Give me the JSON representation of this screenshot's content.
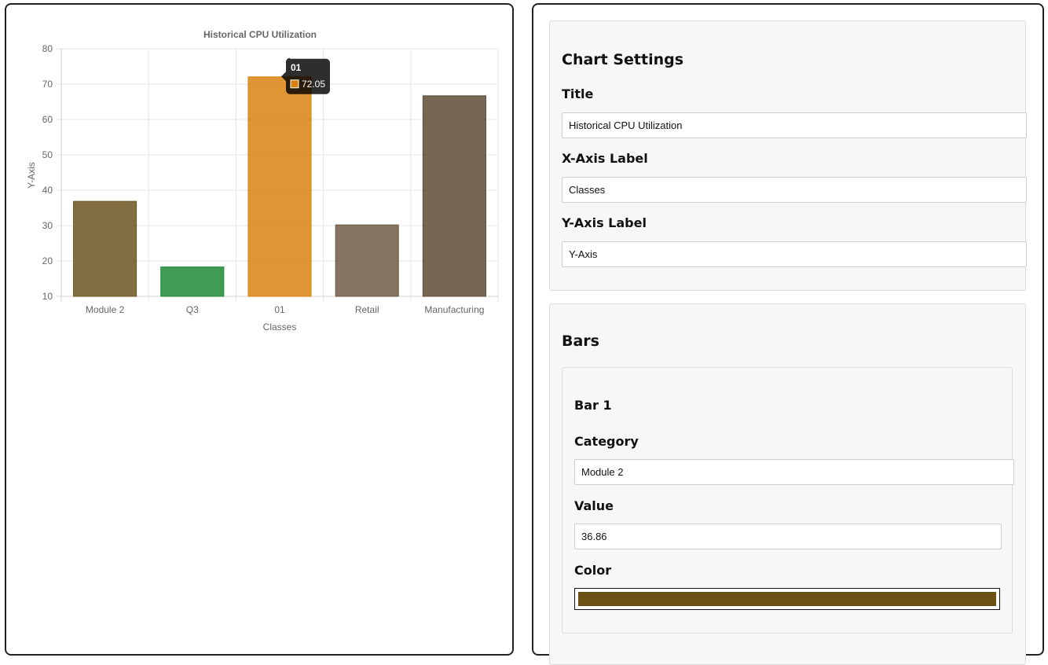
{
  "chart_data": {
    "type": "bar",
    "title": "Historical CPU Utilization",
    "xlabel": "Classes",
    "ylabel": "Y-Axis",
    "categories": [
      "Module 2",
      "Q3",
      "01",
      "Retail",
      "Manufacturing"
    ],
    "values": [
      36.86,
      18.3,
      72.05,
      30.2,
      66.7
    ],
    "colors": [
      "#6b5520",
      "#1f8a35",
      "#d9820f",
      "#6e5a44",
      "#5e4c37"
    ],
    "ylim": [
      10,
      80
    ],
    "yticks": [
      "10",
      "20",
      "30",
      "40",
      "50",
      "60",
      "70",
      "80"
    ],
    "grid": true,
    "tooltip": {
      "title": "01",
      "value": "72.05",
      "color": "#d9820f"
    }
  },
  "settings": {
    "heading": "Chart Settings",
    "title_label": "Title",
    "title_value": "Historical CPU Utilization",
    "xaxis_label": "X-Axis Label",
    "xaxis_value": "Classes",
    "yaxis_label": "Y-Axis Label",
    "yaxis_value": "Y-Axis"
  },
  "bars_section": {
    "heading": "Bars",
    "bar1": {
      "heading": "Bar 1",
      "category_label": "Category",
      "category_value": "Module 2",
      "value_label": "Value",
      "value_value": "36.86",
      "color_label": "Color",
      "color_value": "#6b5214"
    }
  }
}
